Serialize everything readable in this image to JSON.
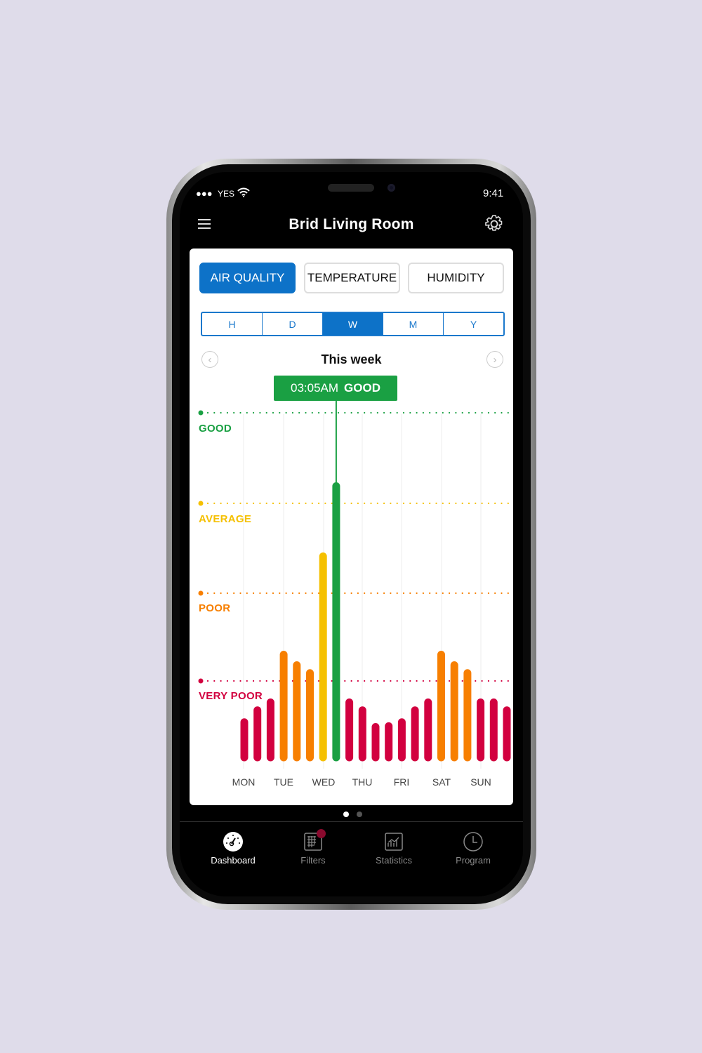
{
  "status_bar": {
    "carrier": "YES",
    "time": "9:41"
  },
  "header": {
    "title": "Brid Living Room",
    "menu_icon": "hamburger-icon",
    "settings_icon": "gear-icon"
  },
  "metric_tabs": [
    {
      "label": "AIR QUALITY",
      "active": true
    },
    {
      "label": "TEMPERATURE",
      "active": false
    },
    {
      "label": "HUMIDITY",
      "active": false
    }
  ],
  "range_tabs": [
    {
      "label": "H",
      "active": false
    },
    {
      "label": "D",
      "active": false
    },
    {
      "label": "W",
      "active": true
    },
    {
      "label": "M",
      "active": false
    },
    {
      "label": "Y",
      "active": false
    }
  ],
  "period_label": "This week",
  "tooltip": {
    "time": "03:05AM",
    "status": "GOOD"
  },
  "chart_data": {
    "type": "bar",
    "categories": [
      "MON",
      "TUE",
      "WED",
      "THU",
      "FRI",
      "SAT",
      "SUN"
    ],
    "levels": [
      {
        "name": "GOOD",
        "value": 4,
        "color": "#1aa043"
      },
      {
        "name": "AVERAGE",
        "value": 3,
        "color": "#f5c000"
      },
      {
        "name": "POOR",
        "value": 2,
        "color": "#f77f00"
      },
      {
        "name": "VERY POOR",
        "value": 1,
        "color": "#d2003f"
      }
    ],
    "values": [
      0.48,
      0.63,
      0.73,
      1.3,
      1.18,
      1.09,
      2.41,
      3.19,
      0.73,
      0.63,
      0.42,
      0.43,
      0.48,
      0.63,
      0.73,
      1.3,
      1.18,
      1.09,
      0.73,
      0.73,
      0.63
    ],
    "bar_colors": [
      "#d2003f",
      "#d2003f",
      "#d2003f",
      "#f77f00",
      "#f77f00",
      "#f77f00",
      "#f5c000",
      "#1aa043",
      "#d2003f",
      "#d2003f",
      "#d2003f",
      "#d2003f",
      "#d2003f",
      "#d2003f",
      "#d2003f",
      "#f77f00",
      "#f77f00",
      "#f77f00",
      "#d2003f",
      "#d2003f",
      "#d2003f"
    ],
    "selected_index": 7,
    "ylim": [
      0,
      4
    ],
    "grid": true
  },
  "pager": {
    "pages": 2,
    "current": 1
  },
  "bottom_nav": [
    {
      "label": "Dashboard",
      "icon": "gauge-icon",
      "active": true
    },
    {
      "label": "Filters",
      "icon": "filter-grid-icon",
      "active": false,
      "badge": true
    },
    {
      "label": "Statistics",
      "icon": "chart-icon",
      "active": false
    },
    {
      "label": "Program",
      "icon": "clock-icon",
      "active": false
    }
  ]
}
